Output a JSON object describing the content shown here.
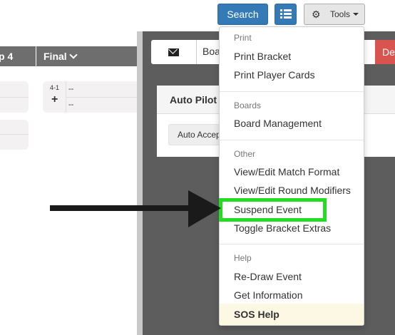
{
  "bracket": {
    "round_headers": [
      "p 4",
      "Final"
    ],
    "final_match": {
      "id": "4-1",
      "add_symbol": "+",
      "slots": [
        "--",
        "--"
      ]
    }
  },
  "toolbar": {
    "search_label": "Search",
    "tools_label": "Tools",
    "list_icon": "list-grid-icon",
    "gear_icon": "gear-icon",
    "primary_color": "#337ab7"
  },
  "message_bar": {
    "input_text": "Boa",
    "delete_label": "De"
  },
  "auto_pilot": {
    "title": "Auto Pilot",
    "accept_label": "Auto Accept"
  },
  "menu": {
    "sections": [
      {
        "header": "Print",
        "items": [
          "Print Bracket",
          "Print Player Cards"
        ]
      },
      {
        "header": "Boards",
        "items": [
          "Board Management"
        ]
      },
      {
        "header": "Other",
        "items": [
          "View/Edit Match Format",
          "View/Edit Round Modifiers",
          "Suspend Event",
          "Toggle Bracket Extras"
        ]
      },
      {
        "header": "Help",
        "items": [
          "Re-Draw Event",
          "Get Information",
          "SOS Help"
        ]
      }
    ],
    "highlighted_item": "Suspend Event",
    "highlight_color": "#22dd22",
    "sos_background": "#fcf8e3"
  }
}
